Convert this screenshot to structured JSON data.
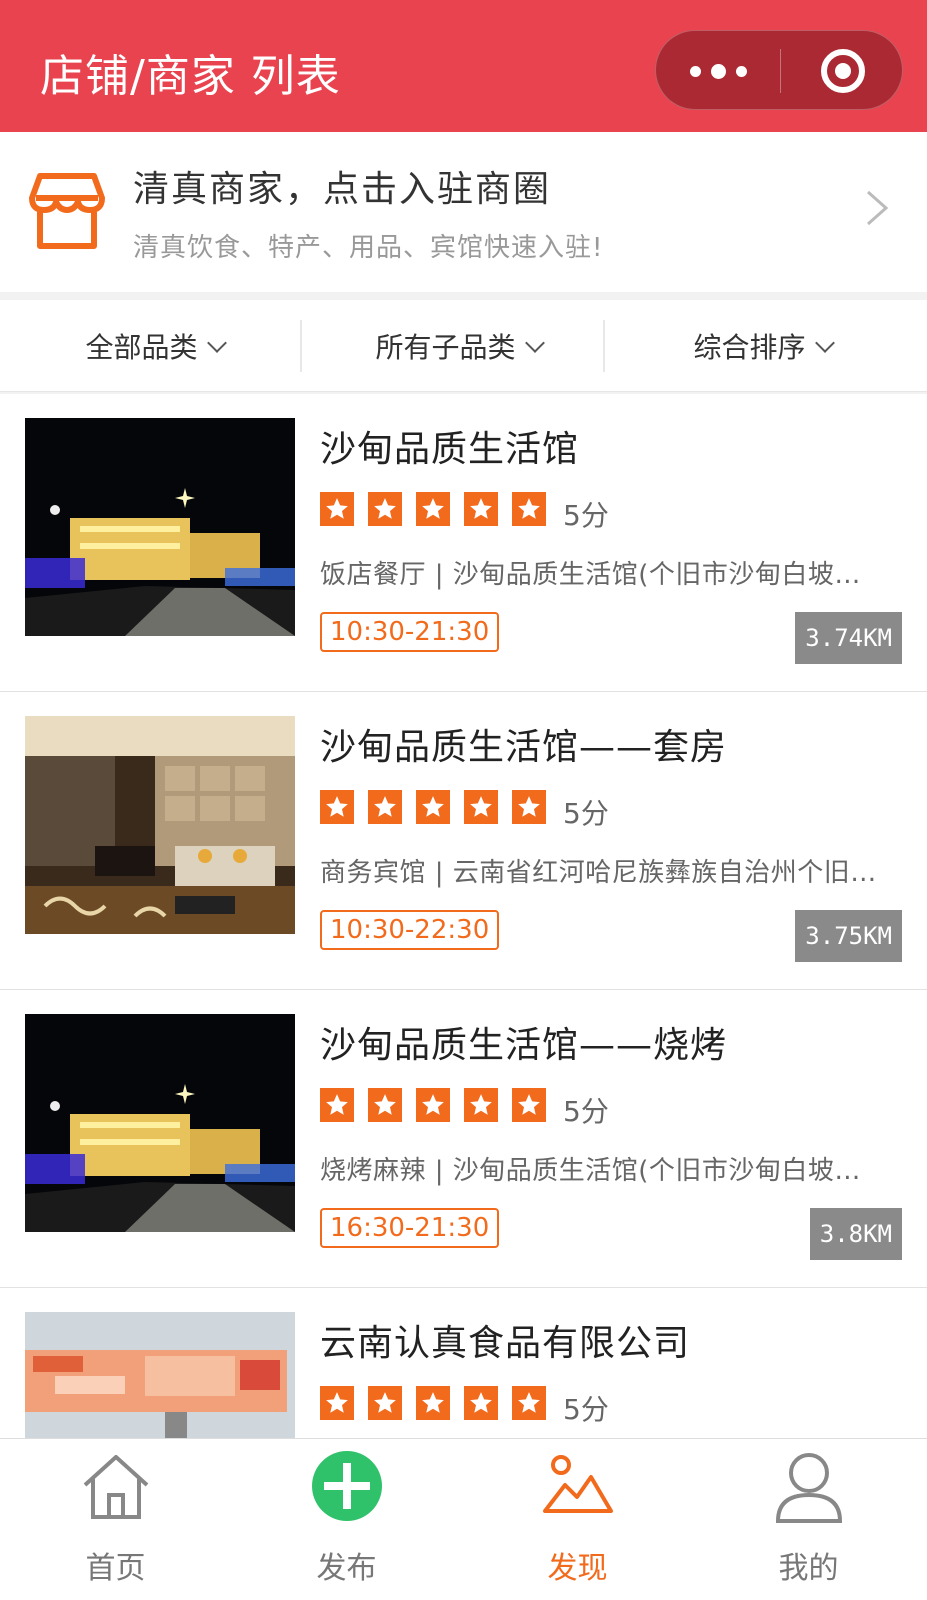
{
  "header": {
    "title": "店铺/商家 列表"
  },
  "banner": {
    "title": "清真商家，点击入驻商圈",
    "subtitle": "清真饮食、特产、用品、宾馆快速入驻!"
  },
  "filters": [
    {
      "label": "全部品类"
    },
    {
      "label": "所有子品类"
    },
    {
      "label": "综合排序"
    }
  ],
  "colors": {
    "brand": "#e8434f",
    "accent": "#f26b1d",
    "tag_bg": "#8a8a8a",
    "publish": "#2fc26b"
  },
  "stores": [
    {
      "name": "沙甸品质生活馆",
      "rating": 5,
      "score": "5分",
      "desc": "饭店餐厅 | 沙甸品质生活馆(个旧市沙甸白坡…",
      "hours": "10:30-21:30",
      "distance": "3.74KM"
    },
    {
      "name": "沙甸品质生活馆——套房",
      "rating": 5,
      "score": "5分",
      "desc": "商务宾馆 | 云南省红河哈尼族彝族自治州个旧…",
      "hours": "10:30-22:30",
      "distance": "3.75KM"
    },
    {
      "name": "沙甸品质生活馆——烧烤",
      "rating": 5,
      "score": "5分",
      "desc": "烧烤麻辣 | 沙甸品质生活馆(个旧市沙甸白坡…",
      "hours": "16:30-21:30",
      "distance": "3.8KM"
    },
    {
      "name": "云南认真食品有限公司",
      "rating": 5,
      "score": "5分",
      "desc": "",
      "hours": "",
      "distance": ""
    }
  ],
  "tabs": [
    {
      "label": "首页",
      "icon": "home-icon"
    },
    {
      "label": "发布",
      "icon": "plus-circle-icon"
    },
    {
      "label": "发现",
      "icon": "mountain-icon",
      "active": true
    },
    {
      "label": "我的",
      "icon": "user-icon"
    }
  ]
}
